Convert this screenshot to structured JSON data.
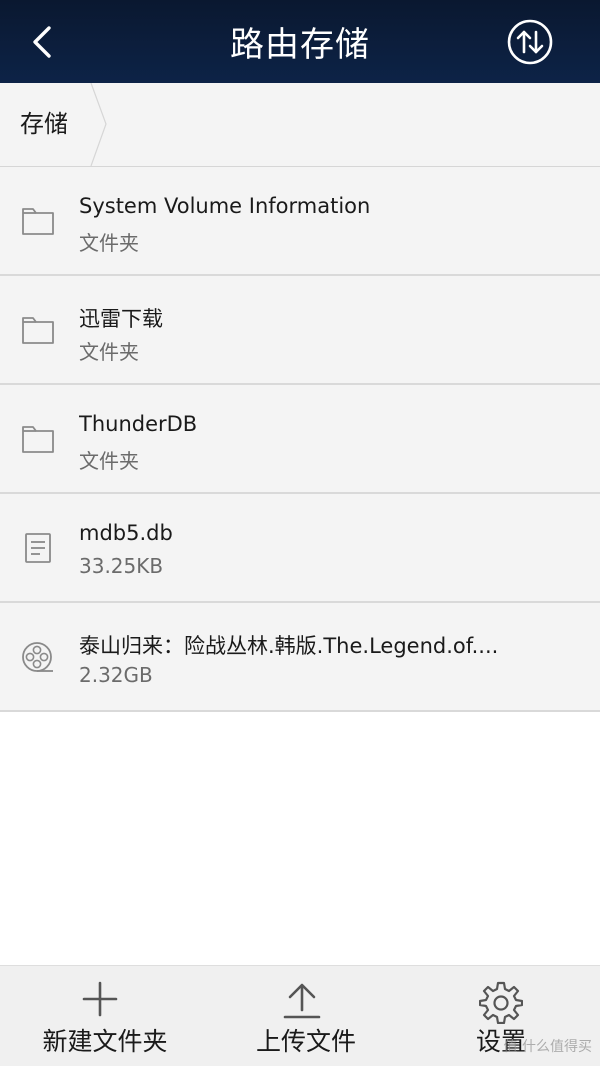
{
  "header": {
    "title": "路由存储",
    "back_icon": "chevron-left-icon",
    "transfer_icon": "up-down-arrows-icon",
    "background": "#0d2347"
  },
  "breadcrumb": {
    "items": [
      {
        "label": "存储"
      }
    ]
  },
  "files": [
    {
      "name": "System Volume Information",
      "meta": "文件夹",
      "icon": "folder-icon"
    },
    {
      "name": "迅雷下载",
      "meta": "文件夹",
      "icon": "folder-icon"
    },
    {
      "name": "ThunderDB",
      "meta": "文件夹",
      "icon": "folder-icon"
    },
    {
      "name": "mdb5.db",
      "meta": "33.25KB",
      "icon": "document-icon"
    },
    {
      "name": "泰山归来：险战丛林.韩版.The.Legend.of....",
      "meta": "2.32GB",
      "icon": "film-reel-icon"
    }
  ],
  "toolbar": {
    "new_folder_label": "新建文件夹",
    "upload_label": "上传文件",
    "settings_label": "设置"
  },
  "watermark": "值 什么值得买"
}
